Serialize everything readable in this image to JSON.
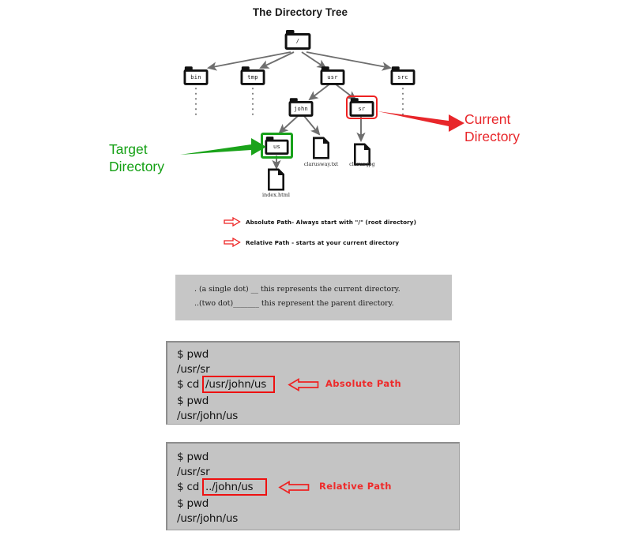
{
  "diagram": {
    "title": "The Directory Tree",
    "nodes": {
      "root": "/",
      "bin": "bin",
      "tmp": "tmp",
      "usr": "usr",
      "src": "src",
      "john": "john",
      "sr": "sr",
      "us": "us",
      "clarusway_txt": "clarusway.txt",
      "clarus_jpg": "clarus.jpg",
      "index_html": "index.html"
    },
    "annotations": {
      "target_directory_line1": "Target",
      "target_directory_line2": "Directory",
      "target_directory_color": "#14a014",
      "current_directory_line1": "Current",
      "current_directory_line2": "Directory",
      "current_directory_color": "#e8262a"
    },
    "path_legend": [
      "Absolute Path- Always start with \"/\"  (root directory)",
      "Relative Path - starts at your current directory"
    ]
  },
  "dot_notation": {
    "line1": ". (a single dot) __  this represents the current directory.",
    "line2": "..(two dot)_______ this represent the parent directory."
  },
  "terminals": [
    {
      "id": "absolute",
      "lines": [
        "$ pwd",
        "/usr/sr",
        "$ cd ",
        "$ pwd",
        "/usr/john/us"
      ],
      "highlighted_command": "/usr/john/us",
      "annotation": "Absolute Path"
    },
    {
      "id": "relative",
      "lines": [
        "$ pwd",
        "/usr/sr",
        "$ cd ",
        "$ pwd",
        "/usr/john/us"
      ],
      "highlighted_command": "../john/us",
      "annotation": "Relative Path"
    }
  ],
  "colors": {
    "accent_red": "#ee2222",
    "accent_green": "#18a11a",
    "box_gray": "#c4c4c4",
    "info_gray": "#c6c6c6"
  }
}
